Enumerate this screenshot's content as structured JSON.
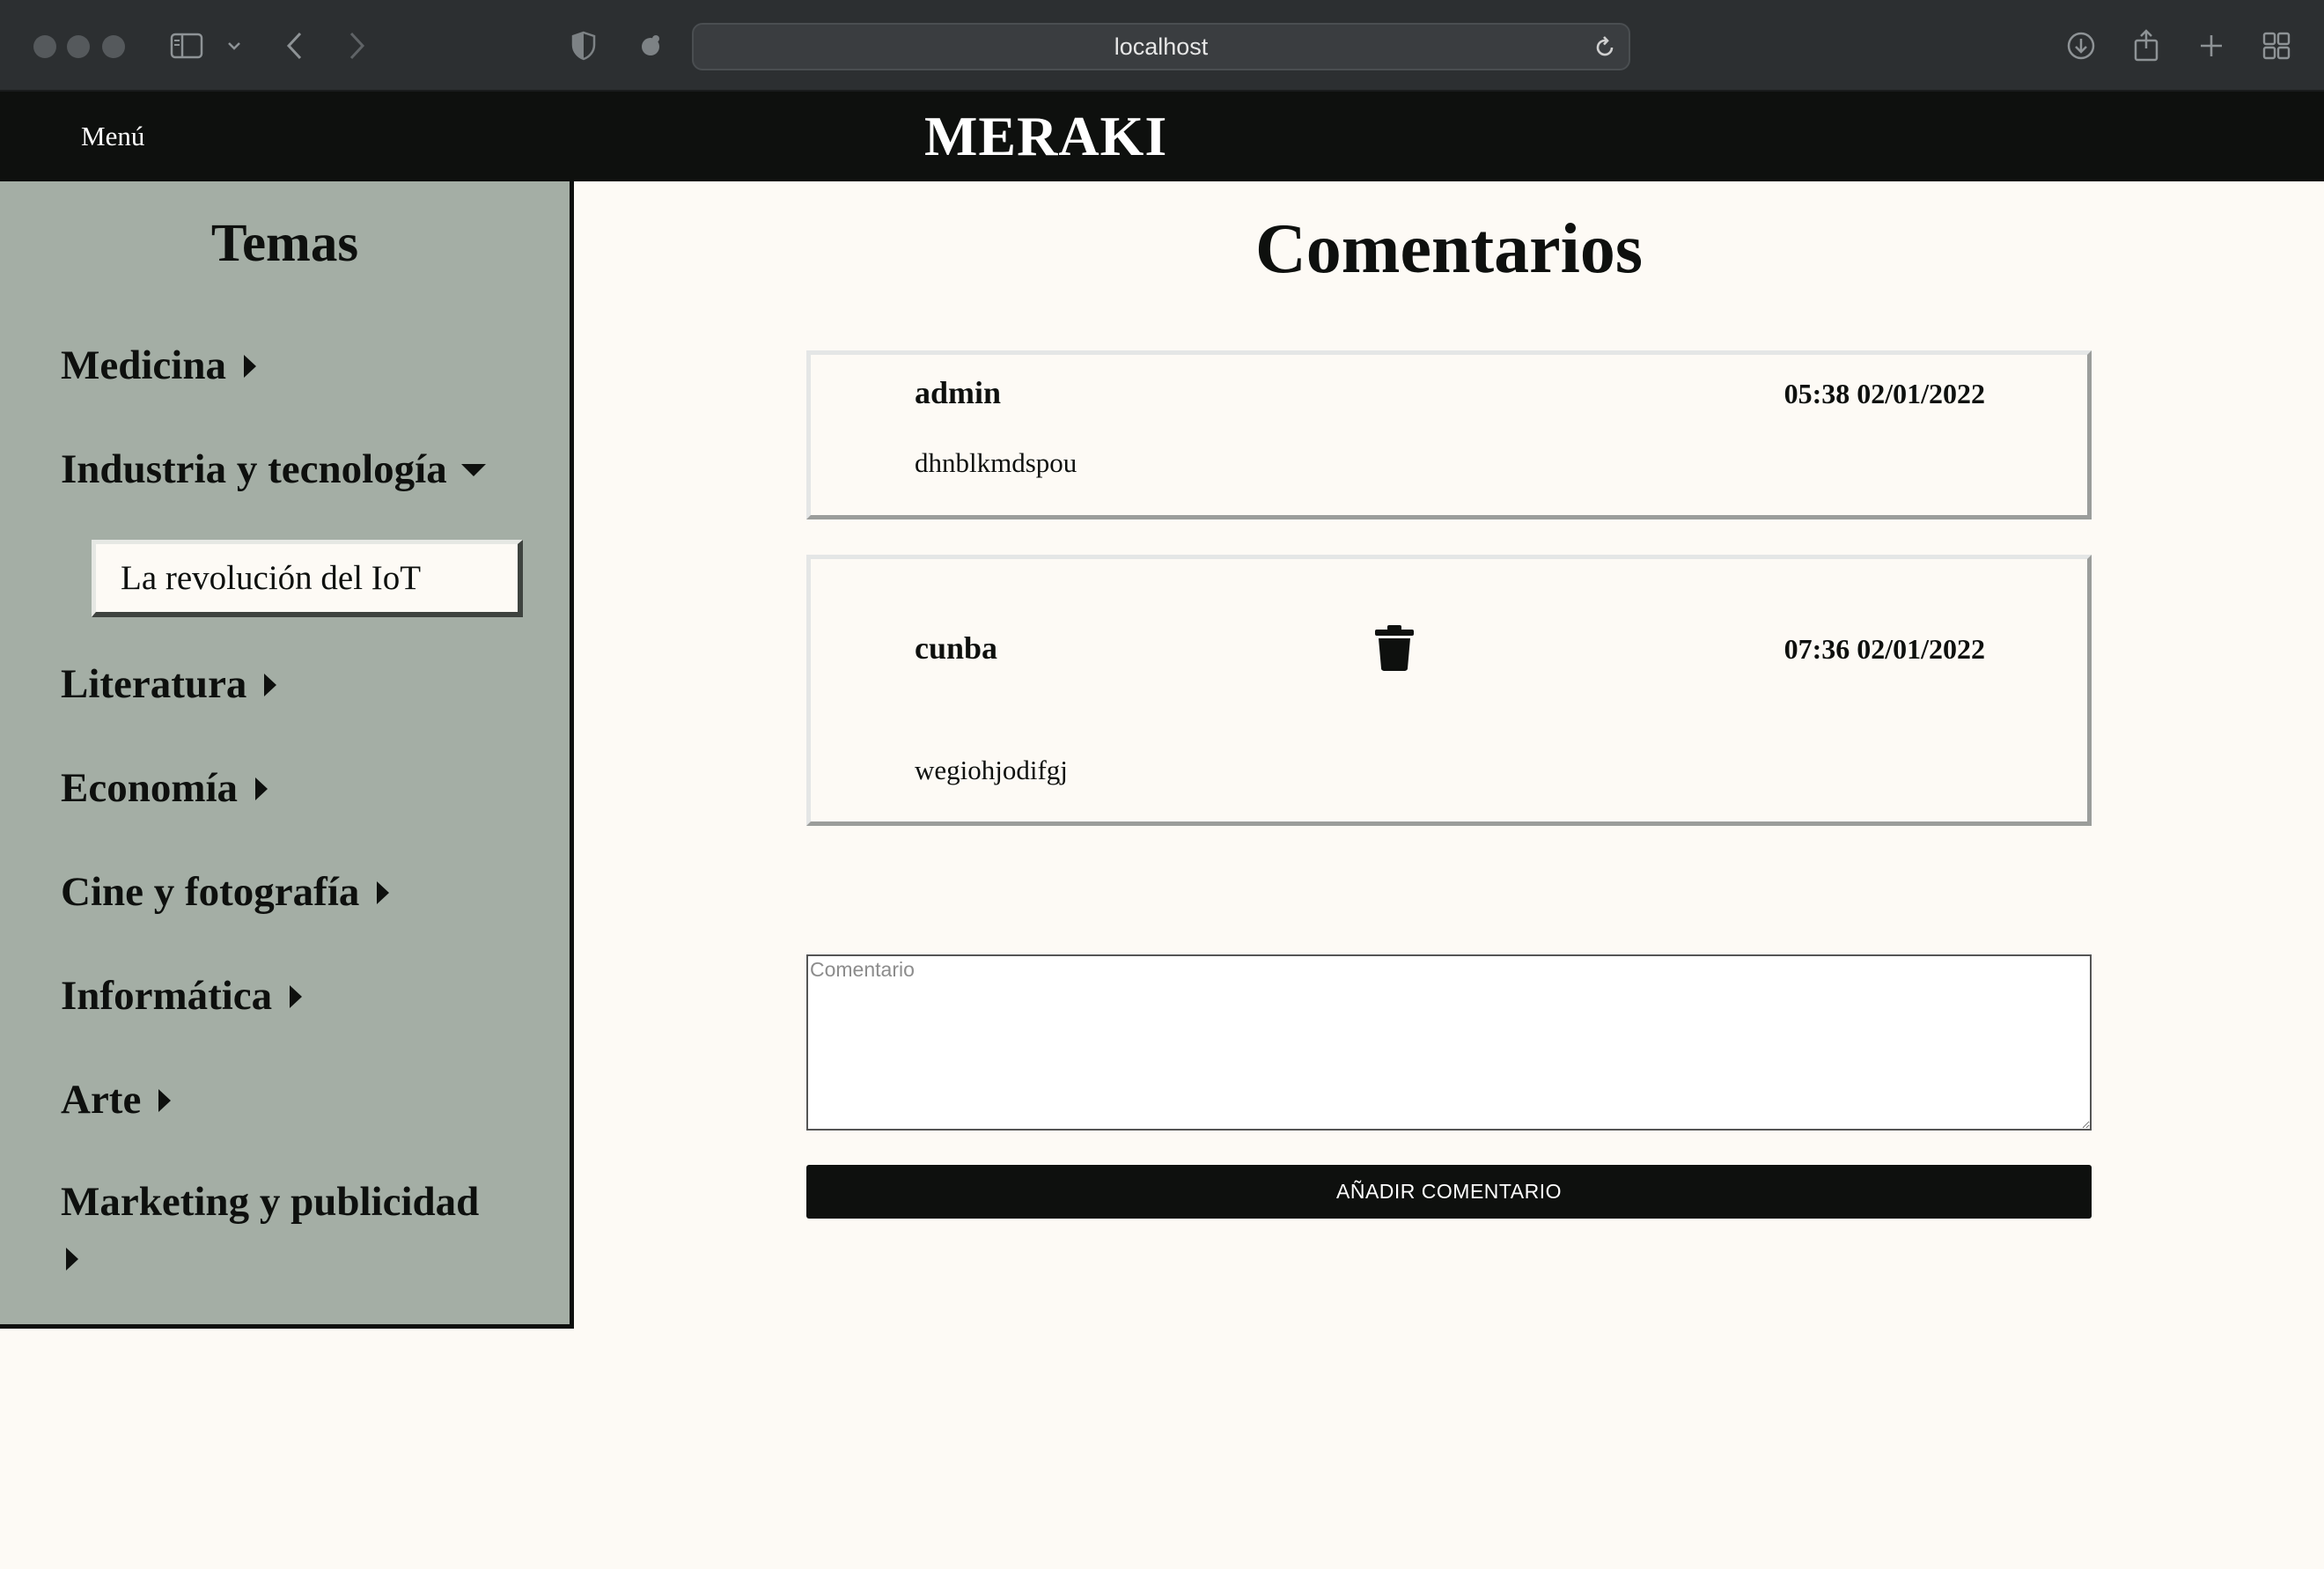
{
  "browser": {
    "url": "localhost"
  },
  "nav": {
    "menu_label": "Menú",
    "brand": "MERAKI"
  },
  "sidebar": {
    "title": "Temas",
    "topics": [
      {
        "label": "Medicina",
        "expanded": false
      },
      {
        "label": "Industria y tecnología",
        "expanded": true,
        "children": [
          "La revolución del IoT"
        ]
      },
      {
        "label": "Literatura",
        "expanded": false
      },
      {
        "label": "Economía",
        "expanded": false
      },
      {
        "label": "Cine y fotografía",
        "expanded": false
      },
      {
        "label": "Informática",
        "expanded": false
      },
      {
        "label": "Arte",
        "expanded": false
      },
      {
        "label": "Marketing y publicidad",
        "expanded": false
      }
    ]
  },
  "main": {
    "title": "Comentarios",
    "comments": [
      {
        "author": "admin",
        "datetime": "05:38 02/01/2022",
        "text": "dhnblkmdspou",
        "deletable": false
      },
      {
        "author": "cunba",
        "datetime": "07:36 02/01/2022",
        "text": "wegiohjodifgj",
        "deletable": true
      }
    ],
    "input_placeholder": "Comentario",
    "input_value": "",
    "submit_label": "AÑADIR COMENTARIO"
  },
  "colors": {
    "nav_bg": "#0e100e",
    "sidebar_bg": "#a4aea5",
    "page_bg": "#fdfaf5",
    "button_bg": "#0e100e"
  }
}
